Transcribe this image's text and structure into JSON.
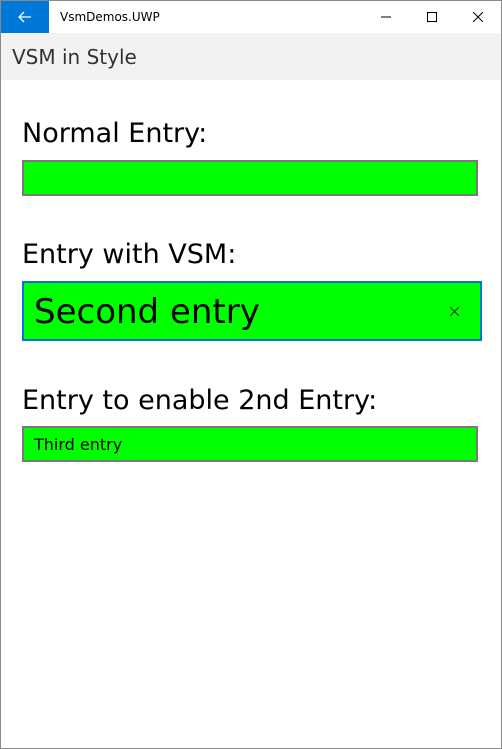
{
  "titlebar": {
    "app_title": "VsmDemos.UWP",
    "back_icon": "back-arrow-icon",
    "minimize_icon": "minimize-icon",
    "maximize_icon": "maximize-icon",
    "close_icon": "close-icon",
    "accent_color": "#0078d7"
  },
  "header": {
    "title": "VSM in Style"
  },
  "form": {
    "normal_label": "Normal Entry:",
    "normal_value": "",
    "vsm_label": "Entry with VSM:",
    "vsm_value": "Second entry",
    "enable_label": "Entry to enable 2nd Entry:",
    "enable_value": "Third entry",
    "entry_background": "#00ff00",
    "focus_border_color": "#0078d7",
    "clear_icon": "clear-x-icon"
  }
}
